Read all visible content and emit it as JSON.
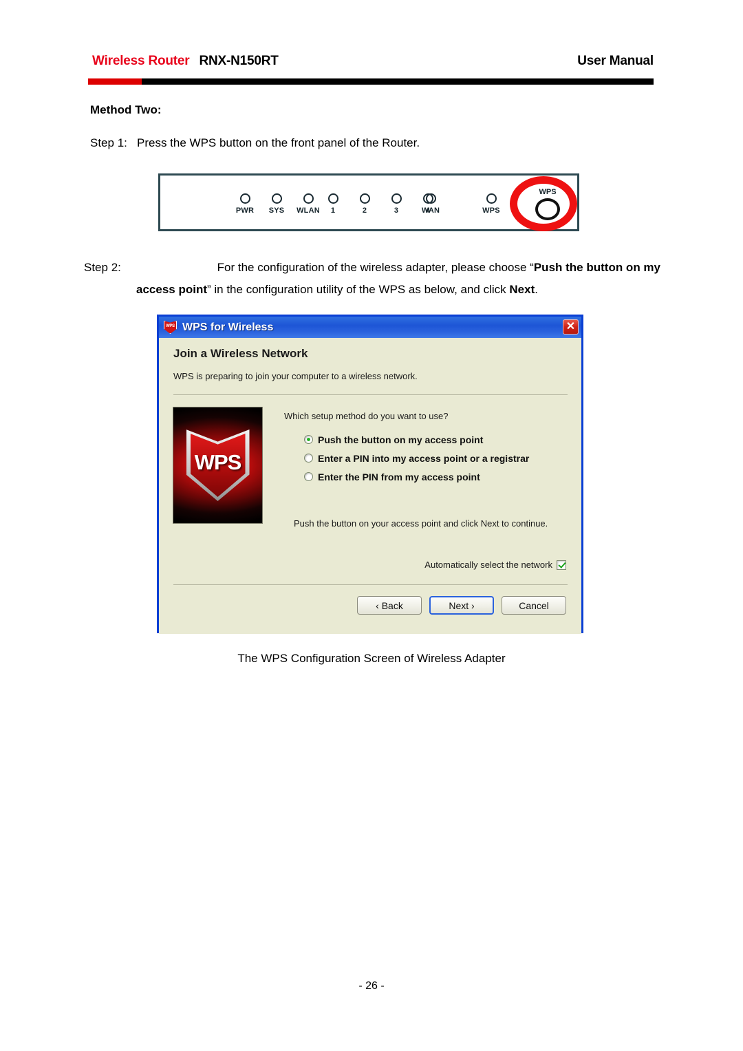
{
  "header": {
    "brand": "Wireless Router",
    "model": "RNX-N150RT",
    "right_label": "User Manual",
    "rule_red": "#dd0000",
    "rule_black": "#000000",
    "brand_color": "#e8031b"
  },
  "content": {
    "method_heading": "Method Two:",
    "step1": {
      "number": "Step 1:",
      "text": "Press the WPS button on the front panel of the Router."
    },
    "step2": {
      "number": "Step 2:",
      "line1_lead": "For the configuration of the wireless adapter, please choose “",
      "line1_bold": "Push the button on my",
      "line2_bold_start": "access point",
      "line2_mid": "” in the configuration utility of the WPS as below, and click ",
      "line2_bold_end": "Next",
      "line2_end": "."
    },
    "figure_caption": "The WPS Configuration Screen of Wireless Adapter",
    "page_number": "- 26 -"
  },
  "router_panel": {
    "led_groups": [
      {
        "name": "status",
        "leds": [
          {
            "label": "PWR"
          },
          {
            "label": "SYS"
          },
          {
            "label": "WLAN"
          }
        ]
      },
      {
        "name": "lan-ports",
        "leds": [
          {
            "label": "1"
          },
          {
            "label": "2"
          },
          {
            "label": "3"
          },
          {
            "label": "4"
          }
        ]
      },
      {
        "name": "network",
        "leds": [
          {
            "label": "WAN"
          },
          {
            "label": "WPS"
          }
        ]
      }
    ],
    "wps_button_caption": "WPS",
    "annotation_color": "#ee1111",
    "border_color": "#2e4a52"
  },
  "wps_dialog": {
    "title": "WPS for Wireless",
    "title_icon_text": "WPS",
    "close_label": "✕",
    "heading": "Join a Wireless Network",
    "subtext": "WPS is preparing to join your computer to a wireless network.",
    "logo_text": "WPS",
    "question": "Which setup method do you want to use?",
    "options": [
      {
        "label": "Push the button on my access point",
        "selected": true
      },
      {
        "label": "Enter a PIN into my access point or a registrar",
        "selected": false
      },
      {
        "label": "Enter the PIN from my access point",
        "selected": false
      }
    ],
    "hint": "Push the button on your access point and click Next to continue.",
    "auto_select_label": "Automatically select the network",
    "auto_select_checked": true,
    "buttons": {
      "back": "‹ Back",
      "next": "Next ›",
      "cancel": "Cancel"
    },
    "titlebar_color": "#1d55d6",
    "body_color": "#e9ead3",
    "border_color": "#0a3fd4",
    "close_color": "#cf2218",
    "accent_green": "#25b425"
  }
}
